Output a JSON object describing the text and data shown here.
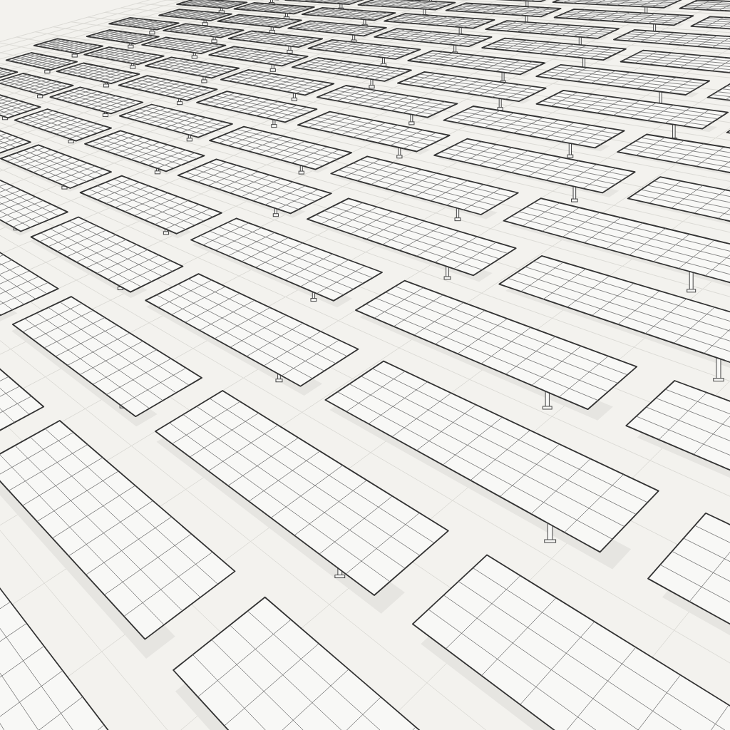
{
  "drawing": {
    "kind": "solar-panel-field"
  }
}
